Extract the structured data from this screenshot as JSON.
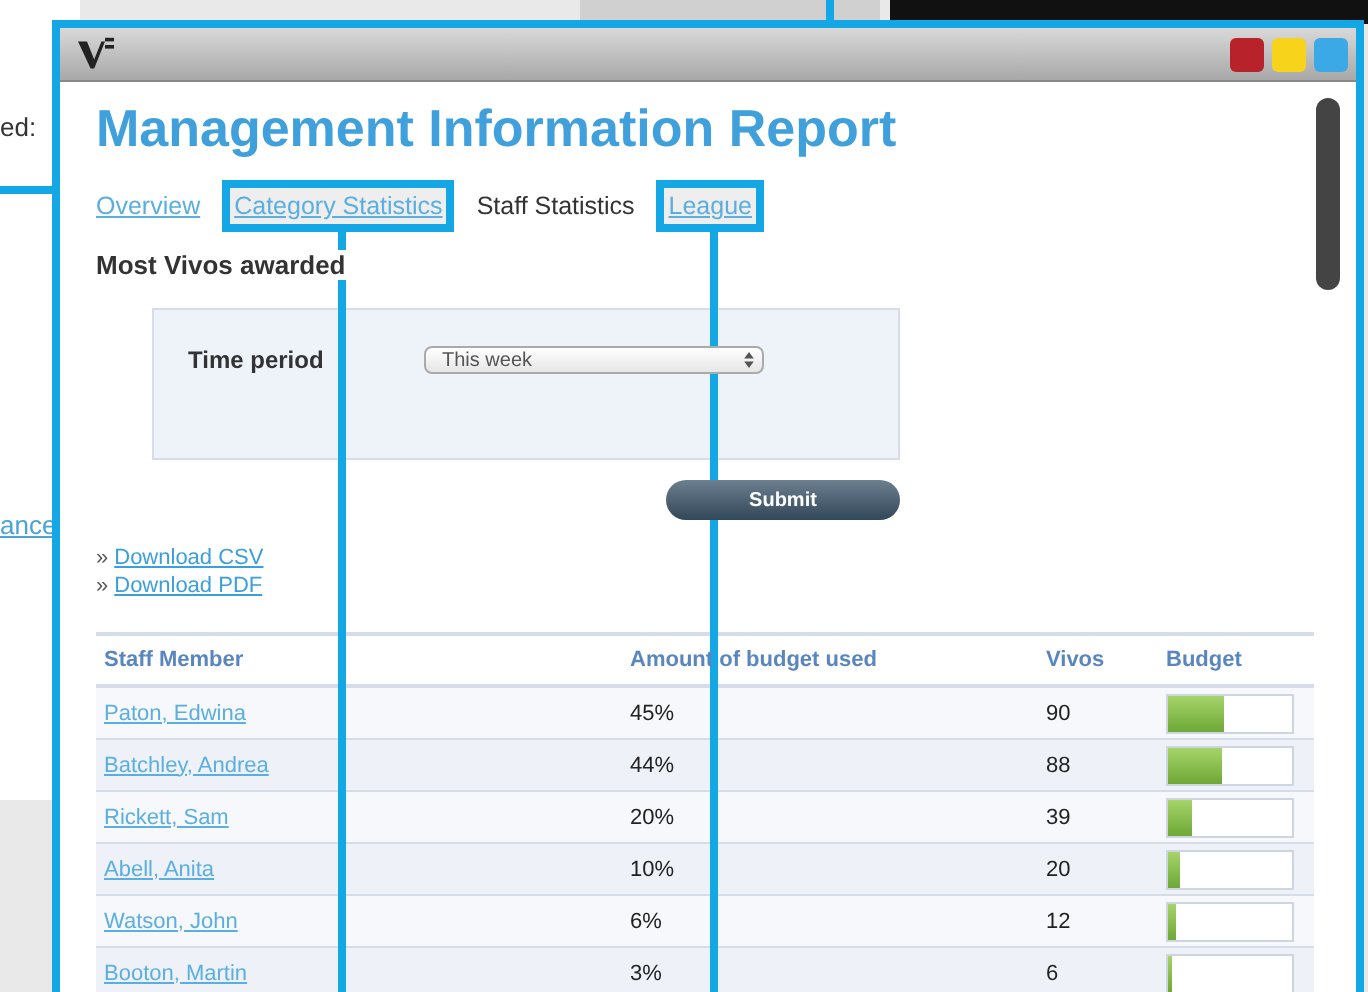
{
  "background_window": {
    "label": "ed:",
    "link": "ance"
  },
  "report": {
    "title": "Management Information Report",
    "tabs": [
      {
        "label": "Overview",
        "selected": false,
        "highlighted": false
      },
      {
        "label": "Category Statistics",
        "selected": false,
        "highlighted": true
      },
      {
        "label": "Staff Statistics",
        "selected": true,
        "highlighted": false
      },
      {
        "label": "League",
        "selected": false,
        "highlighted": true
      }
    ],
    "heading": "Most Vivos awarded",
    "filter": {
      "label": "Time period",
      "value": "This week"
    },
    "submit": "Submit",
    "downloads": [
      {
        "bullet": "»",
        "label": "Download CSV"
      },
      {
        "bullet": "»",
        "label": "Download PDF"
      }
    ],
    "table": {
      "columns": [
        "Staff Member",
        "Amount of budget used",
        "Vivos",
        "Budget"
      ],
      "rows": [
        {
          "name": "Paton, Edwina",
          "amount": "45%",
          "vivos": "90",
          "level": 0.45
        },
        {
          "name": "Batchley, Andrea",
          "amount": "44%",
          "vivos": "88",
          "level": 0.44
        },
        {
          "name": "Rickett, Sam",
          "amount": "20%",
          "vivos": "39",
          "level": 0.2
        },
        {
          "name": "Abell, Anita",
          "amount": "10%",
          "vivos": "20",
          "level": 0.1
        },
        {
          "name": "Watson, John",
          "amount": "6%",
          "vivos": "12",
          "level": 0.06
        },
        {
          "name": "Booton, Martin",
          "amount": "3%",
          "vivos": "6",
          "level": 0.03
        }
      ]
    }
  }
}
